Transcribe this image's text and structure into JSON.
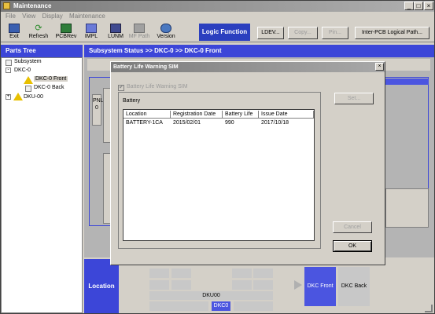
{
  "window": {
    "title": "Maintenance",
    "min": "_",
    "max": "□",
    "close": "×"
  },
  "menu": [
    "File",
    "View",
    "Display",
    "Maintenance"
  ],
  "toolbar": {
    "buttons": [
      {
        "label": "Exit"
      },
      {
        "label": "Refresh"
      },
      {
        "label": "PCBRev"
      },
      {
        "label": "IMPL"
      },
      {
        "label": "LUNM"
      },
      {
        "label": "MF Path"
      },
      {
        "label": "Version"
      }
    ],
    "logic_function": "Logic Function",
    "ldev": "LDEV...",
    "copy": "Copy...",
    "pin": "Pin...",
    "inter_pcb": "Inter-PCB Logical Path..."
  },
  "parts_tree": {
    "title": "Parts Tree",
    "nodes": [
      "Subsystem",
      "DKC-0",
      "DKC-0 Front",
      "DKC-0 Back",
      "DKU-00"
    ]
  },
  "subsystem": {
    "header": "Subsystem Status >> DKC-0 >> DKC-0 Front",
    "panel_label": "PNL 0"
  },
  "bottom": {
    "location": "Location",
    "dku": "DKU00",
    "dkc": "DKC0",
    "front": "DKC Front",
    "back": "DKC Back"
  },
  "dialog": {
    "title": "Battery Life Warning SIM",
    "close": "×",
    "checkbox_label": "Battery Life Warning SIM",
    "group_label": "Battery",
    "columns": [
      "Location",
      "Registration Date",
      "Battery Life",
      "Issue Date"
    ],
    "rows": [
      [
        "BATTERY-1CA",
        "2015/02/01",
        "990",
        "2017/10/18"
      ]
    ],
    "set_button": "Set...",
    "cancel_button": "Cancel",
    "ok_button": "OK"
  },
  "colors": {
    "accent": "#3c46d8",
    "selected_tab": "#4b55e0"
  }
}
